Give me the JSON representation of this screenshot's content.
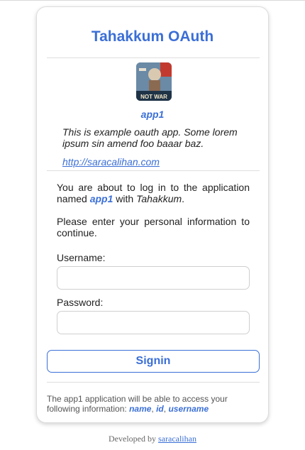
{
  "header": {
    "title": "Tahakkum OAuth"
  },
  "app": {
    "name": "app1",
    "description": "This is example oauth app. Some lorem ipsum sin amend foo baaar baz.",
    "url": "http://saracalihan.com",
    "logo_text": "NOT WAR"
  },
  "intro": {
    "part1": "You are about to log in to the application named ",
    "app_name": "app1",
    "part2": " with ",
    "service": "Tahakkum",
    "part3": "."
  },
  "instruction": "Please enter your personal information to continue.",
  "form": {
    "username_label": "Username:",
    "username_value": "",
    "password_label": "Password:",
    "password_value": "",
    "signin_label": "Signin"
  },
  "permissions": {
    "text": "The app1 application will be able to access your following information: ",
    "fields": [
      "name",
      "id",
      "username"
    ],
    "sep": ", "
  },
  "footer": {
    "developed_by": "Developed by ",
    "author": "saracalihan"
  },
  "colors": {
    "accent": "#3b6fd6",
    "border": "#dcdcdc"
  }
}
